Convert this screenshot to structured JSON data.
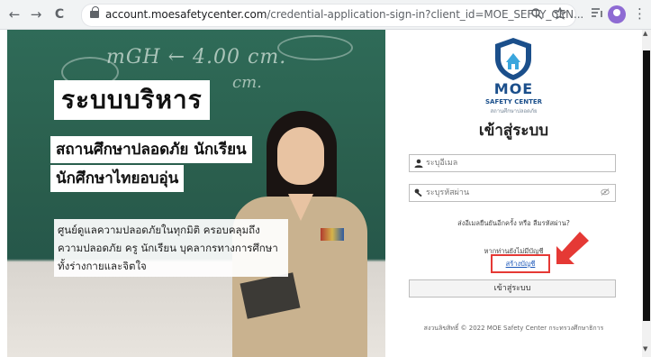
{
  "browser": {
    "url_domain": "account.moesafetycenter.com",
    "url_path": "/credential-application-sign-in?client_id=MOE_SEFTY_CEN...",
    "back_glyph": "←",
    "forward_glyph": "→",
    "reload_glyph": "C",
    "menu_glyph": "⋮"
  },
  "hero": {
    "chalk_line1": "mGH ← 4.00 cm.",
    "chalk_line2": "cm.",
    "title": "ระบบบริหาร",
    "subtitle1": "สถานศึกษาปลอดภัย นักเรียน",
    "subtitle2": "นักศึกษาไทยอบอุ่น",
    "description": "ศูนย์ดูแลความปลอดภัยในทุกมิติ ครอบคลุมถึงความปลอดภัย ครู นักเรียน บุคลากรทางการศึกษา ทั้งร่างกายและจิตใจ"
  },
  "login": {
    "brand_name": "MOE",
    "brand_sub": "SAFETY CENTER",
    "brand_thai": "สถานศึกษาปลอดภัย",
    "heading": "เข้าสู่ระบบ",
    "email_placeholder": "ระบุอีเมล",
    "password_placeholder": "ระบุรหัสผ่าน",
    "resend_text": "ส่งอีเมลยืนยันอีกครั้ง",
    "or_text": "หรือ",
    "forgot_text": "ลืมรหัสผ่าน?",
    "no_account_text": "หากท่านยังไม่มีบัญชี",
    "register_link": "สร้างบัญชี",
    "login_button": "เข้าสู่ระบบ",
    "footer": "สงวนลิขสิทธิ์ © 2022 MOE Safety Center กระทรวงศึกษาธิการ"
  },
  "colors": {
    "brand_blue": "#1b4f8b",
    "highlight_red": "#e53935",
    "link_blue": "#1a56b8"
  }
}
